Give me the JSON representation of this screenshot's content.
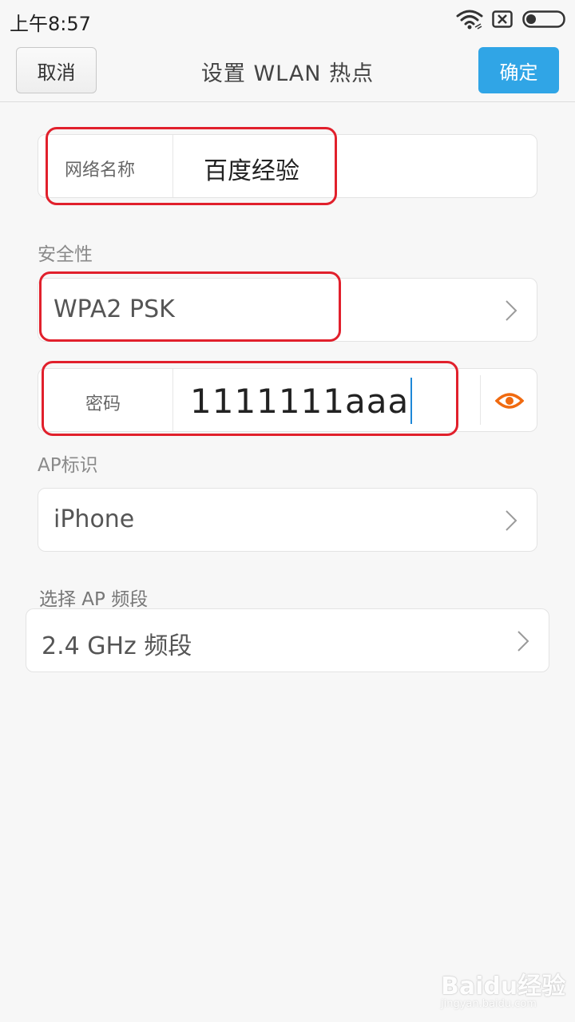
{
  "status_bar": {
    "time": "上午8:57",
    "icons": [
      "wifi-icon",
      "sim-icon",
      "battery-icon"
    ]
  },
  "header": {
    "cancel_label": "取消",
    "title": "设置 WLAN 热点",
    "confirm_label": "确定",
    "confirm_color": "#30a5e6"
  },
  "form": {
    "network_name": {
      "label": "网络名称",
      "value": "百度经验"
    },
    "security": {
      "section_label": "安全性",
      "value": "WPA2 PSK"
    },
    "password": {
      "label": "密码",
      "value": "1111111aaa",
      "toggle_icon": "eye-icon"
    },
    "ap_id": {
      "section_label": "AP标识",
      "value": "iPhone"
    },
    "band": {
      "section_label": "选择 AP 频段",
      "value": "2.4 GHz 频段"
    }
  },
  "annotation_color": "#e1202c",
  "watermark": {
    "main": "Baidu经验",
    "sub": "jingyan.baidu.com"
  }
}
